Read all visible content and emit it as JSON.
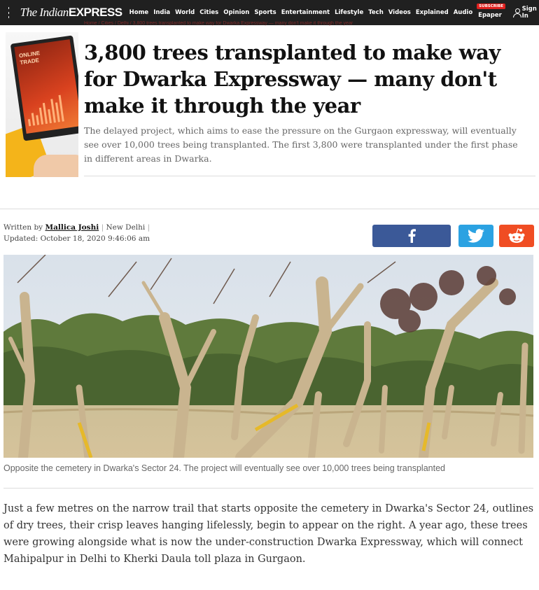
{
  "header": {
    "logo_prefix": "The Indian",
    "logo_suffix": "EXPRESS",
    "nav_items": [
      "Home",
      "India",
      "World",
      "Cities",
      "Opinion",
      "Sports",
      "Entertainment",
      "Lifestyle",
      "Tech",
      "Videos",
      "Explained",
      "Audio"
    ],
    "epaper_badge": "SUBSCRIBE",
    "epaper_label": "Epaper",
    "signin_label": "Sign In"
  },
  "breadcrumb": "Home / Cities / Delhi / 3,800 trees transplanted to make way for Dwarka Expressway — many don't make it through the year",
  "thumb": {
    "screen_text_1": "ONLINE",
    "screen_text_2": "TRADE"
  },
  "article": {
    "headline": "3,800 trees transplanted to make way for Dwarka Expressway — many don't make it through the year",
    "standfirst": "The delayed project, which aims to ease the pressure on the Gurgaon expressway, will eventually see over 10,000 trees being transplanted. The first 3,800 were transplanted under the first phase in different areas in Dwarka.",
    "written_by_label": "Written by",
    "author": "Mallica Joshi",
    "location": "New Delhi",
    "updated": "Updated: October 18, 2020 9:46:06 am",
    "caption": "Opposite the cemetery in Dwarka's Sector 24. The project will eventually see over 10,000 trees being transplanted",
    "body": "Just a few metres on the narrow trail that starts opposite the cemetery in Dwarka's Sector 24, outlines of dry trees, their crisp leaves hanging lifelessly, begin to appear on the right. A year ago, these trees were growing alongside what is now the under-construction Dwarka Expressway, which will connect Mahipalpur in Delhi to Kherki Daula toll plaza in Gurgaon."
  },
  "share": {
    "facebook_icon": "facebook-f-icon",
    "twitter_icon": "twitter-bird-icon",
    "reddit_icon": "reddit-alien-icon"
  },
  "colors": {
    "topbar": "#202020",
    "brand_red": "#e0201e",
    "facebook": "#3b5998",
    "twitter": "#2ba2e2",
    "reddit": "#f04d23"
  }
}
